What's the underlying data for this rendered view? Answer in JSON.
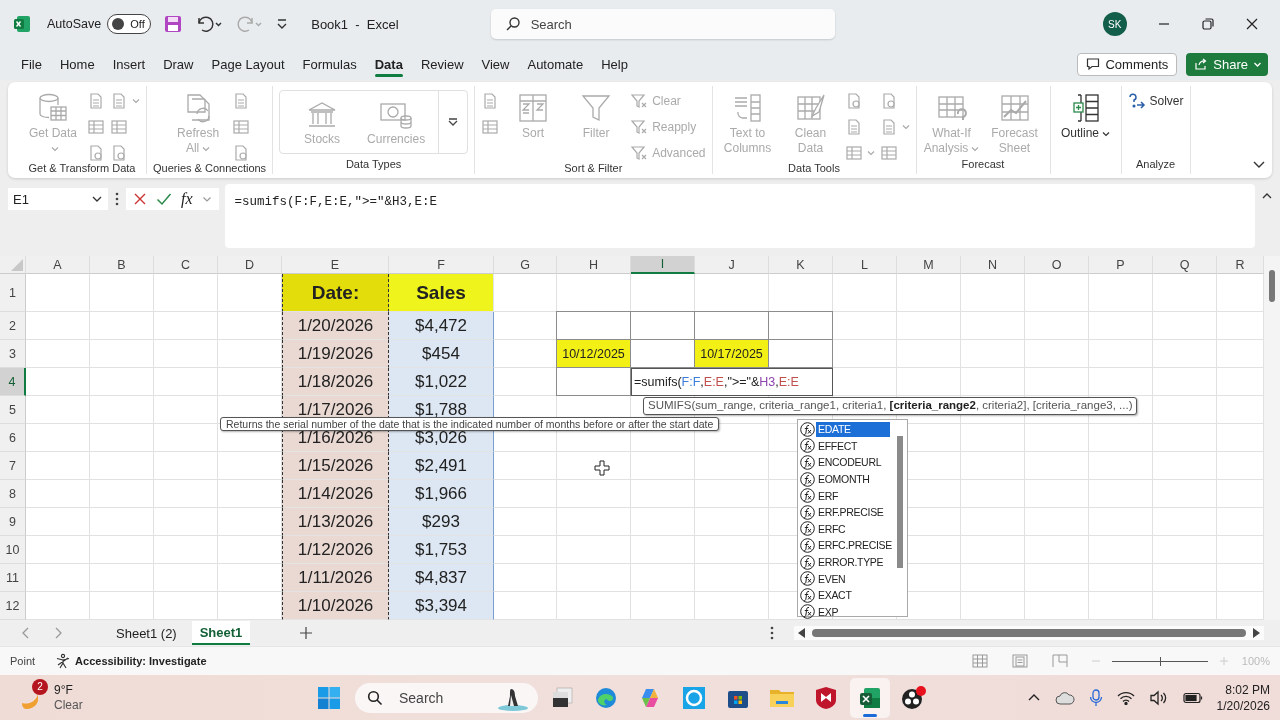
{
  "title_bar": {
    "autosave_label": "AutoSave",
    "autosave": {
      "on": false,
      "label": "Off"
    },
    "title": "Book1  -  Excel",
    "search": {
      "placeholder": "Search"
    },
    "avatar": "SK"
  },
  "menu_tabs": [
    {
      "label": "File",
      "selected": false
    },
    {
      "label": "Home",
      "selected": false
    },
    {
      "label": "Insert",
      "selected": false
    },
    {
      "label": "Draw",
      "selected": false
    },
    {
      "label": "Page Layout",
      "selected": false
    },
    {
      "label": "Formulas",
      "selected": false
    },
    {
      "label": "Data",
      "selected": true
    },
    {
      "label": "Review",
      "selected": false
    },
    {
      "label": "View",
      "selected": false
    },
    {
      "label": "Automate",
      "selected": false
    },
    {
      "label": "Help",
      "selected": false
    }
  ],
  "comments_button": "Comments",
  "share_button": "Share",
  "ribbon": {
    "groups": [
      {
        "label": "Get & Transform Data",
        "controls": [
          {
            "kind": "large",
            "label": "Get Data",
            "caret": true,
            "disabled": true
          },
          {
            "kind": "stack",
            "items": [
              {
                "disabled": true
              },
              {
                "disabled": true
              },
              {
                "disabled": true
              }
            ]
          },
          {
            "kind": "stack",
            "items": [
              {
                "disabled": true,
                "caret": true
              },
              {
                "disabled": true
              },
              {
                "disabled": true
              }
            ]
          }
        ]
      },
      {
        "label": "Queries & Connections",
        "controls": [
          {
            "kind": "large",
            "label": "Refresh All",
            "caret": true,
            "disabled": true
          },
          {
            "kind": "stack",
            "items": [
              {
                "disabled": true
              },
              {
                "disabled": true
              },
              {
                "disabled": true
              }
            ]
          }
        ]
      },
      {
        "label": "Data Types",
        "controls": [
          {
            "kind": "gallery",
            "items": [
              {
                "label": "Stocks",
                "disabled": true
              },
              {
                "label": "Currencies",
                "disabled": true
              }
            ]
          }
        ]
      },
      {
        "label": "Sort & Filter",
        "controls": [
          {
            "kind": "stack",
            "items": [
              {
                "disabled": true
              },
              {
                "disabled": true
              }
            ]
          },
          {
            "kind": "large",
            "label": "Sort",
            "disabled": true
          },
          {
            "kind": "large",
            "label": "Filter",
            "disabled": true
          },
          {
            "kind": "stack",
            "items": [
              {
                "label": "Clear",
                "disabled": true
              },
              {
                "label": "Reapply",
                "disabled": true
              },
              {
                "label": "Advanced",
                "disabled": true
              }
            ]
          }
        ]
      },
      {
        "label": "Data Tools",
        "controls": [
          {
            "kind": "large",
            "label": "Text to Columns",
            "disabled": true
          },
          {
            "kind": "large",
            "label": "Clean Data",
            "disabled": true
          },
          {
            "kind": "stack",
            "items": [
              {
                "disabled": true
              },
              {
                "disabled": true
              },
              {
                "disabled": true,
                "caret": true
              }
            ]
          },
          {
            "kind": "stack",
            "items": [
              {
                "disabled": true
              },
              {
                "disabled": true,
                "caret": true
              },
              {
                "disabled": true
              }
            ]
          }
        ]
      },
      {
        "label": "Forecast",
        "controls": [
          {
            "kind": "large",
            "label": "What-If Analysis",
            "caret": true,
            "disabled": true
          },
          {
            "kind": "large",
            "label": "Forecast Sheet",
            "disabled": true
          }
        ]
      },
      {
        "controls": [
          {
            "kind": "large",
            "label": "Outline",
            "caret": true,
            "disabled": false
          }
        ]
      },
      {
        "label": "Analyze",
        "controls": [
          {
            "kind": "stack",
            "items": [
              {
                "label": "Solver",
                "disabled": false
              }
            ]
          }
        ]
      }
    ]
  },
  "formula_bar": {
    "name_box": "E1",
    "function_label": "fx",
    "formula": "=sumifs(F:F,E:E,\">=\"&H3,E:E"
  },
  "sheet": {
    "columns": [
      {
        "label": "A",
        "selected": false
      },
      {
        "label": "B",
        "selected": false
      },
      {
        "label": "C",
        "selected": false
      },
      {
        "label": "D",
        "selected": false
      },
      {
        "label": "E",
        "selected": false
      },
      {
        "label": "F",
        "selected": false
      },
      {
        "label": "G",
        "selected": false
      },
      {
        "label": "H",
        "selected": false
      },
      {
        "label": "I",
        "selected": true
      },
      {
        "label": "J",
        "selected": false
      },
      {
        "label": "K",
        "selected": false
      },
      {
        "label": "L",
        "selected": false
      },
      {
        "label": "M",
        "selected": false
      },
      {
        "label": "N",
        "selected": false
      },
      {
        "label": "O",
        "selected": false
      },
      {
        "label": "P",
        "selected": false
      },
      {
        "label": "Q",
        "selected": false
      },
      {
        "label": "R",
        "selected": false
      }
    ],
    "rows": [
      {
        "label": "1",
        "selected": false
      },
      {
        "label": "2",
        "selected": false
      },
      {
        "label": "3",
        "selected": false
      },
      {
        "label": "4",
        "selected": true
      },
      {
        "label": "5",
        "selected": false
      },
      {
        "label": "6",
        "selected": false
      },
      {
        "label": "7",
        "selected": false
      },
      {
        "label": "8",
        "selected": false
      },
      {
        "label": "9",
        "selected": false
      },
      {
        "label": "10",
        "selected": false
      },
      {
        "label": "11",
        "selected": false
      },
      {
        "label": "12",
        "selected": false
      }
    ],
    "table": {
      "headers": [
        "Date:",
        "Sales"
      ],
      "rows": [
        [
          "1/20/2026",
          "$4,472"
        ],
        [
          "1/19/2026",
          "$454"
        ],
        [
          "1/18/2026",
          "$1,022"
        ],
        [
          "1/17/2026",
          "$1,788"
        ],
        [
          "1/16/2026",
          "$3,026"
        ],
        [
          "1/15/2026",
          "$2,491"
        ],
        [
          "1/14/2026",
          "$1,966"
        ],
        [
          "1/13/2026",
          "$293"
        ],
        [
          "1/12/2026",
          "$1,753"
        ],
        [
          "1/11/2026",
          "$4,837"
        ],
        [
          "1/10/2026",
          "$3,394"
        ]
      ]
    },
    "date_inputs": [
      "10/12/2025",
      "10/17/2025"
    ],
    "cell_editor": {
      "segments": [
        {
          "kind": "text",
          "text": "=sumifs("
        },
        {
          "kind": "range",
          "text": "F:F",
          "color": "#3b7dd8"
        },
        {
          "kind": "text",
          "text": ","
        },
        {
          "kind": "range",
          "text": "E:E",
          "color": "#c0504d"
        },
        {
          "kind": "text",
          "text": ",\">=\"&"
        },
        {
          "kind": "range",
          "text": "H3",
          "color": "#8e44ad"
        },
        {
          "kind": "text",
          "text": ","
        },
        {
          "kind": "range",
          "text": "E:E",
          "color": "#c0504d"
        }
      ]
    },
    "function_tooltip": "SUMIFS(sum_range, criteria_range1, criteria1, **[criteria_range2**, criteria2], [criteria_range3, ...)",
    "description_tooltip": "Returns the serial number of the date that is the indicated number of months before or after the start date",
    "autocomplete": [
      {
        "label": "EDATE",
        "selected": true
      },
      {
        "label": "EFFECT",
        "selected": false
      },
      {
        "label": "ENCODEURL",
        "selected": false
      },
      {
        "label": "EOMONTH",
        "selected": false
      },
      {
        "label": "ERF",
        "selected": false
      },
      {
        "label": "ERF.PRECISE",
        "selected": false
      },
      {
        "label": "ERFC",
        "selected": false
      },
      {
        "label": "ERFC.PRECISE",
        "selected": false
      },
      {
        "label": "ERROR.TYPE",
        "selected": false
      },
      {
        "label": "EVEN",
        "selected": false
      },
      {
        "label": "EXACT",
        "selected": false
      },
      {
        "label": "EXP",
        "selected": false
      }
    ]
  },
  "sheet_tabs": [
    {
      "label": "Sheet1 (2)",
      "selected": false
    },
    {
      "label": "Sheet1",
      "selected": true
    }
  ],
  "status_bar": {
    "mode": "Point",
    "accessibility": "Accessibility: Investigate",
    "zoom_slider": {
      "level": 0.5
    },
    "zoom": "100%"
  },
  "taskbar": {
    "weather": {
      "badge": "2",
      "temperature": "9°F",
      "condition": "Clear"
    },
    "search": {
      "placeholder": "Search"
    },
    "apps": [
      {
        "kind": "taskview",
        "active": false
      },
      {
        "kind": "edge",
        "active": false
      },
      {
        "kind": "copilot",
        "active": false
      },
      {
        "kind": "alexa",
        "active": false
      },
      {
        "kind": "store",
        "active": false
      },
      {
        "kind": "explorer",
        "active": false
      },
      {
        "kind": "shield",
        "active": false
      },
      {
        "kind": "excel",
        "active": true
      },
      {
        "kind": "recorder",
        "active": false
      }
    ],
    "clock": {
      "time": "8:02 PM",
      "date": "1/20/2026"
    }
  }
}
